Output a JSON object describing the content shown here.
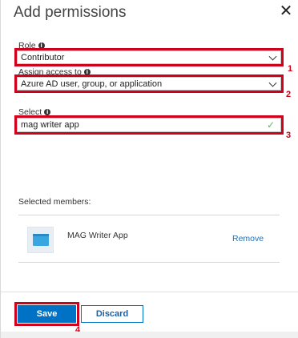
{
  "panel": {
    "title": "Add permissions",
    "close_glyph": "✕"
  },
  "role": {
    "label": "Role",
    "value": "Contributor"
  },
  "assign_access": {
    "label": "Assign access to",
    "value": "Azure AD user, group, or application"
  },
  "select": {
    "label": "Select",
    "value": "mag writer app"
  },
  "info_glyph": "i",
  "check_glyph": "✓",
  "selected_members": {
    "label": "Selected members:",
    "items": [
      {
        "name": "MAG Writer App",
        "action": "Remove"
      }
    ]
  },
  "footer": {
    "save_label": "Save",
    "discard_label": "Discard"
  },
  "annotations": {
    "step1": "1",
    "step2": "2",
    "step3": "3",
    "step4": "4",
    "highlight_color": "#d0021b"
  },
  "colors": {
    "primary_button": "#0072c6",
    "link": "#1f6fb5",
    "valid_check": "#5cb85c"
  }
}
